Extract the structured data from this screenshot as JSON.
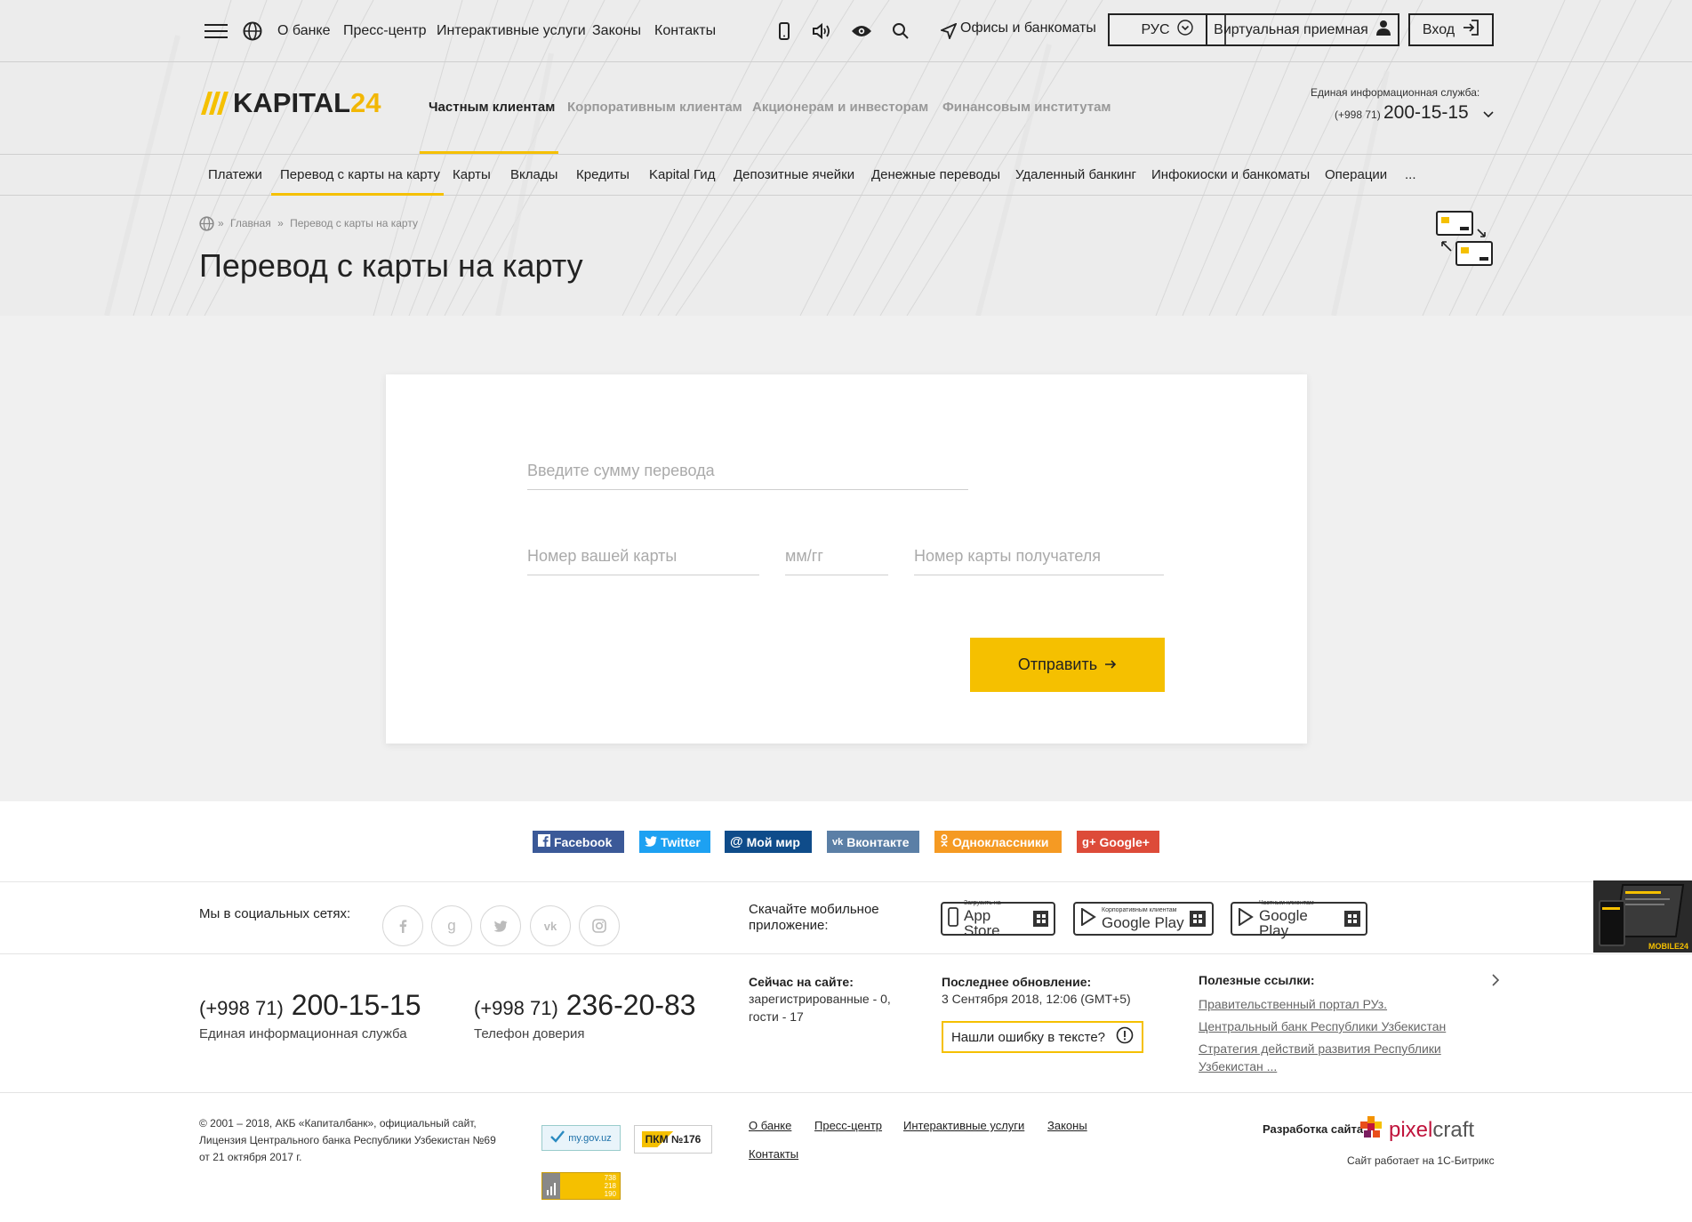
{
  "topbar": {
    "links": [
      "О банке",
      "Пресс-центр",
      "Интерактивные услуги",
      "Законы",
      "Контакты"
    ],
    "offices_label": "Офисы и банкоматы",
    "lang_label": "РУС",
    "virtual_label": "Виртуальная приемная",
    "login_label": "Вход"
  },
  "logo": {
    "brand": "KAPITAL",
    "num": "24"
  },
  "mainnav": [
    "Частным клиентам",
    "Корпоративным клиентам",
    "Акционерам и инвесторам",
    "Финансовым институтам"
  ],
  "hotline": {
    "label": "Единая информационная служба:",
    "code": "(+998 71)",
    "number": "200-15-15"
  },
  "subnav": [
    "Платежи",
    "Перевод с карты на карту",
    "Карты",
    "Вклады",
    "Кредиты",
    "Kapital Гид",
    "Депозитные ячейки",
    "Денежные переводы",
    "Удаленный банкинг",
    "Инфокиоски и банкоматы",
    "Операции",
    "..."
  ],
  "breadcrumb": {
    "home": "Главная",
    "sep": "»",
    "current": "Перевод с карты на карту"
  },
  "page": {
    "title": "Перевод с карты на карту"
  },
  "form": {
    "amount_placeholder": "Введите сумму перевода",
    "card_from_placeholder": "Номер вашей карты",
    "expiry_placeholder": "мм/гг",
    "card_to_placeholder": "Номер карты получателя",
    "submit_label": "Отправить"
  },
  "share": [
    {
      "label": "Facebook",
      "color": "#3b5998",
      "icon": "f"
    },
    {
      "label": "Twitter",
      "color": "#1da1f2",
      "icon": "t"
    },
    {
      "label": "Мой мир",
      "color": "#168de2",
      "icon": "@"
    },
    {
      "label": "Вконтакте",
      "color": "#5b7fa6",
      "icon": "vk"
    },
    {
      "label": "Одноклассники",
      "color": "#f59a23",
      "icon": "ok"
    },
    {
      "label": "Google+",
      "color": "#dd4b39",
      "icon": "g+"
    }
  ],
  "footer": {
    "social_label": "Мы в социальных сетях:",
    "social_icons": [
      "f",
      "g",
      "t",
      "vk",
      "ig"
    ],
    "app_label": "Скачайте мобильное приложение:",
    "stores": [
      {
        "small": "Загрузить на",
        "big": "App Store"
      },
      {
        "small": "Корпоративным клиентам",
        "big": "Google Play"
      },
      {
        "small": "Частным клиентам",
        "big": "Google Play"
      }
    ],
    "phone1": {
      "code": "(+998 71)",
      "number": "200-15-15",
      "label": "Единая информационная служба"
    },
    "phone2": {
      "code": "(+998 71)",
      "number": "236-20-83",
      "label": "Телефон доверия"
    },
    "online_title": "Сейчас на сайте:",
    "online_text1": "зарегистрированные - 0,",
    "online_text2": "гости - 17",
    "updated_title": "Последнее обновление:",
    "updated_text": "3 Сентября 2018, 12:06 (GMT+5)",
    "error_label": "Нашли ошибку в тексте?",
    "useful_title": "Полезные ссылки:",
    "useful_links": [
      "Правительственный портал РУз.",
      "Центральный банк Республики Узбекистан",
      "Стратегия действий развития Республики",
      "Узбекистан ..."
    ],
    "copyright1": "© 2001 – 2018, АКБ «Капиталбанк», официальный сайт,",
    "copyright2": "Лицензия Центрального банка Республики Узбекистан №69",
    "copyright3": "от 21 октября 2017 г.",
    "badge_gov": "my.gov.uz",
    "badge_pkm": "ПКМ №176",
    "counter_lines": [
      "738",
      "218",
      "190"
    ],
    "bottom_links": [
      "О банке",
      "Пресс-центр",
      "Интерактивные услуги",
      "Законы",
      "Контакты"
    ],
    "dev_label": "Разработка сайта",
    "dev_brand1": "pixel",
    "dev_brand2": "craft",
    "bitrix": "Сайт работает на 1С-Битрикс",
    "promo_label": "MOBILE24"
  },
  "colors": {
    "accent": "#f5c000",
    "text": "#222222",
    "bg": "#f0f0f0"
  }
}
